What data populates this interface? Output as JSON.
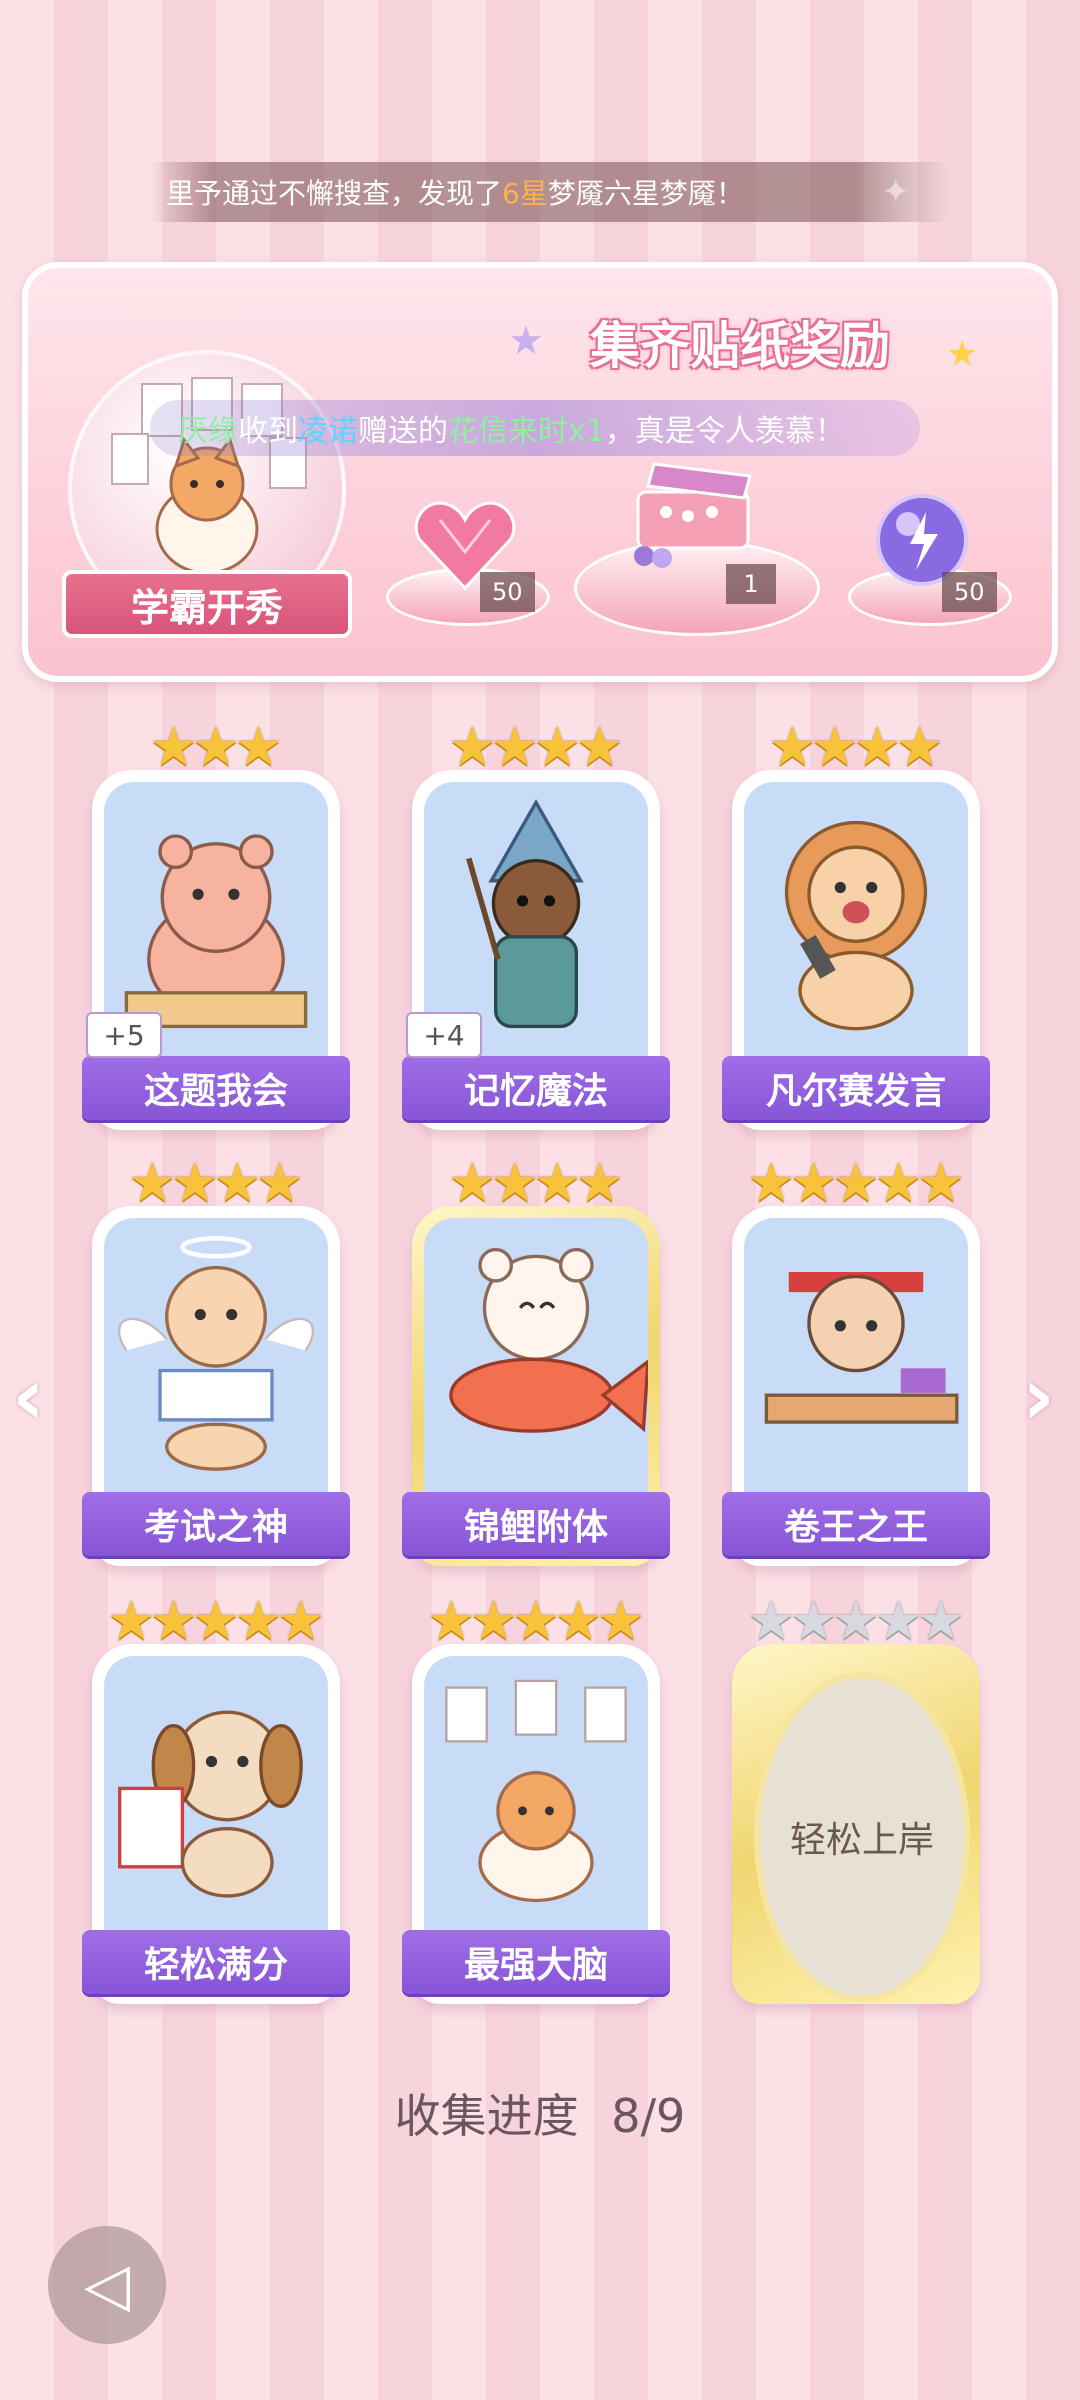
{
  "marquee": {
    "pre": "里予通过不懈搜查，发现了",
    "highlight": "6星",
    "post": "梦魇六星梦魇！"
  },
  "banner": {
    "title": "集齐贴纸奖励",
    "badge_label": "学霸开秀",
    "notice": {
      "name1": "厌缘",
      "text1": "收到",
      "name2": "凌诺",
      "text2": "赠送的",
      "item": "花信来时x1",
      "text3": "，真是令人羡慕！"
    },
    "rewards": [
      {
        "icon": "heart-crystal-icon",
        "count": "50"
      },
      {
        "icon": "gift-box-icon",
        "count": "1"
      },
      {
        "icon": "energy-orb-icon",
        "count": "50"
      }
    ]
  },
  "cards": [
    {
      "label": "这题我会",
      "stars": 3,
      "bonus": "+5",
      "icon": "bear-at-desk-icon"
    },
    {
      "label": "记忆魔法",
      "stars": 4,
      "bonus": "+4",
      "icon": "wizard-otter-icon"
    },
    {
      "label": "凡尔赛发言",
      "stars": 4,
      "bonus": "",
      "icon": "lion-microphone-icon"
    },
    {
      "label": "考试之神",
      "stars": 4,
      "bonus": "",
      "icon": "angel-cat-icon"
    },
    {
      "label": "锦鲤附体",
      "stars": 4,
      "bonus": "",
      "icon": "bear-koi-icon"
    },
    {
      "label": "卷王之王",
      "stars": 5,
      "bonus": "",
      "icon": "studying-cat-icon"
    },
    {
      "label": "轻松满分",
      "stars": 5,
      "bonus": "",
      "icon": "puppy-full-score-icon"
    },
    {
      "label": "最强大脑",
      "stars": 5,
      "bonus": "",
      "icon": "cat-brain-icon"
    },
    {
      "label": "轻松上岸",
      "stars": 5,
      "bonus": "",
      "icon": "locked-card-icon",
      "locked": true
    }
  ],
  "progress": {
    "label": "收集进度",
    "value": "8/9"
  },
  "colors": {
    "label_purple": "#8e5ddc",
    "star_gold": "#f8c33a",
    "background_pink": "#fbe0e6"
  }
}
